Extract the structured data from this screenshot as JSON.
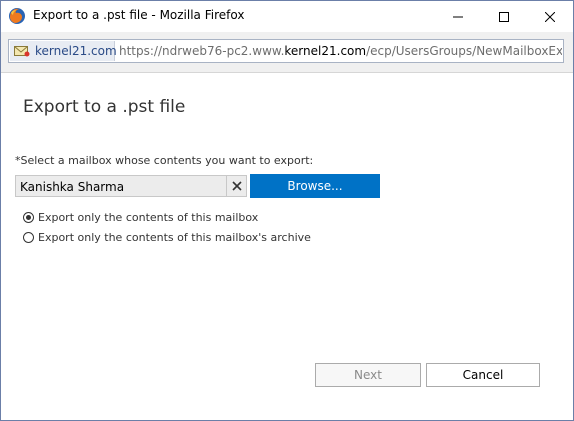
{
  "window": {
    "title": "Export to a .pst file - Mozilla Firefox",
    "controls": [
      "minimize",
      "maximize",
      "close"
    ]
  },
  "address_bar": {
    "domain": "kernel21.com",
    "url_prefix": "https://ndrweb76-pc2.www.",
    "url_host": "kernel21.com",
    "url_suffix": "/ecp/UsersGroups/NewMailboxExportR"
  },
  "dialog": {
    "title": "Export to a .pst file",
    "mailbox_prompt": "*Select a mailbox whose contents you want to export:",
    "mailbox_value": "Kanishka Sharma",
    "browse_label": "Browse...",
    "options": [
      {
        "label": "Export only the contents of this mailbox",
        "checked": true
      },
      {
        "label": "Export only the contents of this mailbox's archive",
        "checked": false
      }
    ],
    "next_label": "Next",
    "next_enabled": false,
    "cancel_label": "Cancel"
  },
  "colors": {
    "accent": "#0072c6",
    "text": "#333333"
  }
}
